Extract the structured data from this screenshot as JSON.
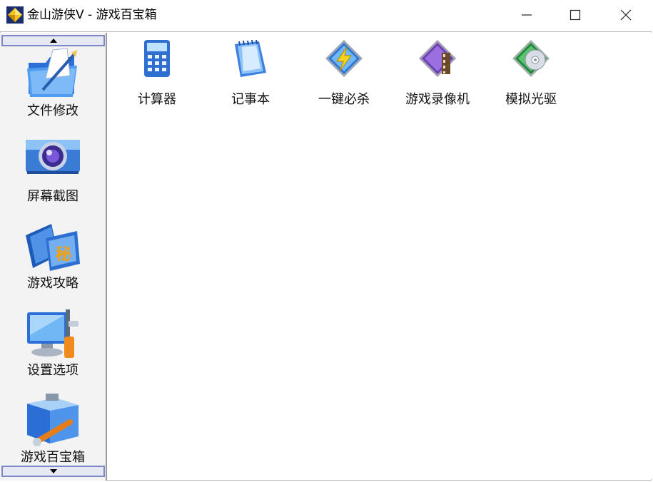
{
  "window": {
    "title": "金山游侠V - 游戏百宝箱",
    "minimize_label": "minimize",
    "maximize_label": "maximize",
    "close_label": "close"
  },
  "sidebar": {
    "items": [
      {
        "label": "文件修改",
        "icon": "folder-edit-icon"
      },
      {
        "label": "屏幕截图",
        "icon": "camera-icon"
      },
      {
        "label": "游戏攻略",
        "icon": "guide-book-icon"
      },
      {
        "label": "设置选项",
        "icon": "settings-monitor-icon"
      },
      {
        "label": "游戏百宝箱",
        "icon": "toolbox-icon"
      }
    ]
  },
  "tools": [
    {
      "label": "计算器",
      "icon": "calculator-icon"
    },
    {
      "label": "记事本",
      "icon": "notepad-icon"
    },
    {
      "label": "一键必杀",
      "icon": "lightning-shield-icon"
    },
    {
      "label": "游戏录像机",
      "icon": "video-recorder-icon"
    },
    {
      "label": "模拟光驱",
      "icon": "virtual-cd-icon"
    }
  ],
  "colors": {
    "sidebar_bg": "#f3f3f3",
    "scroll_border": "#7f86c9",
    "scroll_bg": "#e6e9f2"
  }
}
